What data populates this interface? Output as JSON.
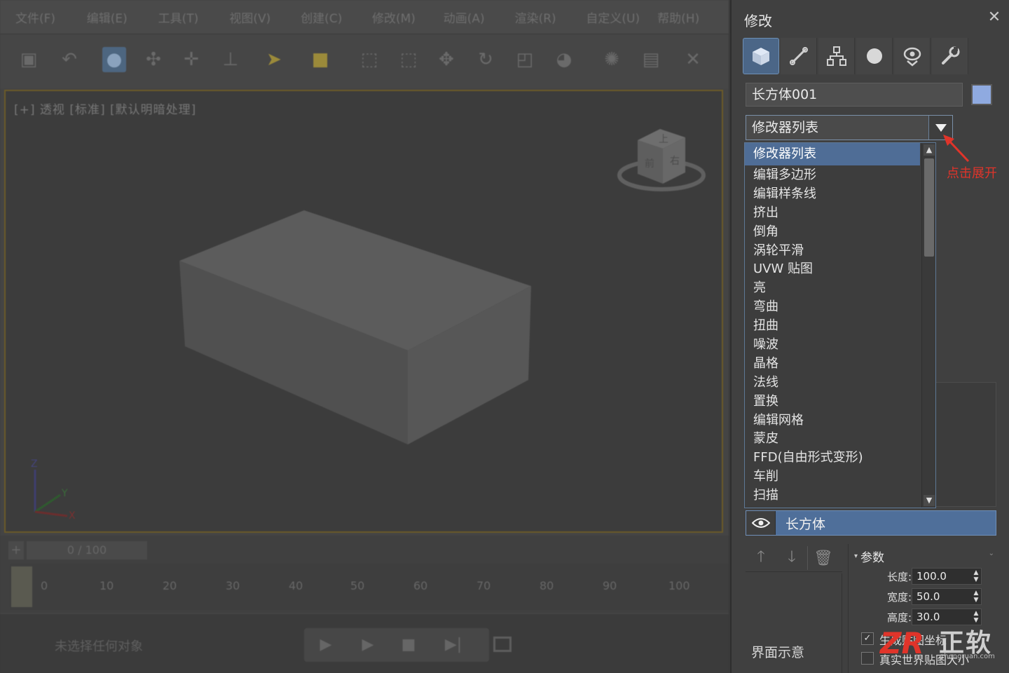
{
  "menu": [
    "文件(F)",
    "编辑(E)",
    "工具(T)",
    "视图(V)",
    "创建(C)",
    "修改(M)",
    "动画(A)",
    "渲染(R)",
    "自定义(U)",
    "帮助(H)"
  ],
  "viewport": {
    "label": "[+] 透视 [标准] [默认明暗处理]",
    "viewcube": {
      "top": "上",
      "front": "前",
      "right": "右"
    },
    "axis": {
      "x": "X",
      "y": "Y",
      "z": "Z"
    }
  },
  "timeline": {
    "counter": "0 / 100",
    "plus": "+",
    "ticks": [
      "0",
      "10",
      "20",
      "30",
      "40",
      "50",
      "60",
      "70",
      "80",
      "90",
      "100"
    ]
  },
  "status": {
    "text": "未选择任何对象"
  },
  "panel": {
    "title": "修改",
    "close_icon": "close-icon",
    "tabs": [
      {
        "name": "create-tab",
        "icon": "cube-icon"
      },
      {
        "name": "modify-tab",
        "icon": "curve-edit-icon"
      },
      {
        "name": "hierarchy-tab",
        "icon": "hierarchy-icon"
      },
      {
        "name": "motion-tab",
        "icon": "circle-icon"
      },
      {
        "name": "display-tab",
        "icon": "monitor-icon"
      },
      {
        "name": "utilities-tab",
        "icon": "wrench-icon"
      }
    ],
    "object_name": "长方体001",
    "object_color": "#8faae0",
    "modifier_list_label": "修改器列表",
    "annotation": "点击展开",
    "dropdown_items": [
      "修改器列表",
      "编辑多边形",
      "编辑样条线",
      "挤出",
      "倒角",
      "涡轮平滑",
      "UVW 贴图",
      "亮",
      "弯曲",
      "扭曲",
      "噪波",
      "晶格",
      "法线",
      "置换",
      "编辑网格",
      "蒙皮",
      "FFD(自由形式变形)",
      "车削",
      "扫描"
    ],
    "stack_item": "长方体",
    "interface_label": "界面示意",
    "params": {
      "title": "参数",
      "length_label": "长度:",
      "length_value": "100.0",
      "width_label": "宽度:",
      "width_value": "50.0",
      "height_label": "高度:",
      "height_value": "30.0",
      "checkbox1_label": "生成贴图坐标",
      "checkbox1_checked": true,
      "checkbox2_label": "真实世界贴图大小",
      "checkbox2_checked": false
    },
    "watermark": {
      "logo": "ZR",
      "text": "正软",
      "url": "zhengruan.com"
    }
  },
  "colors": {
    "accent": "#4f6d96",
    "annotation": "#e0342a",
    "panel_bg": "#404040"
  }
}
